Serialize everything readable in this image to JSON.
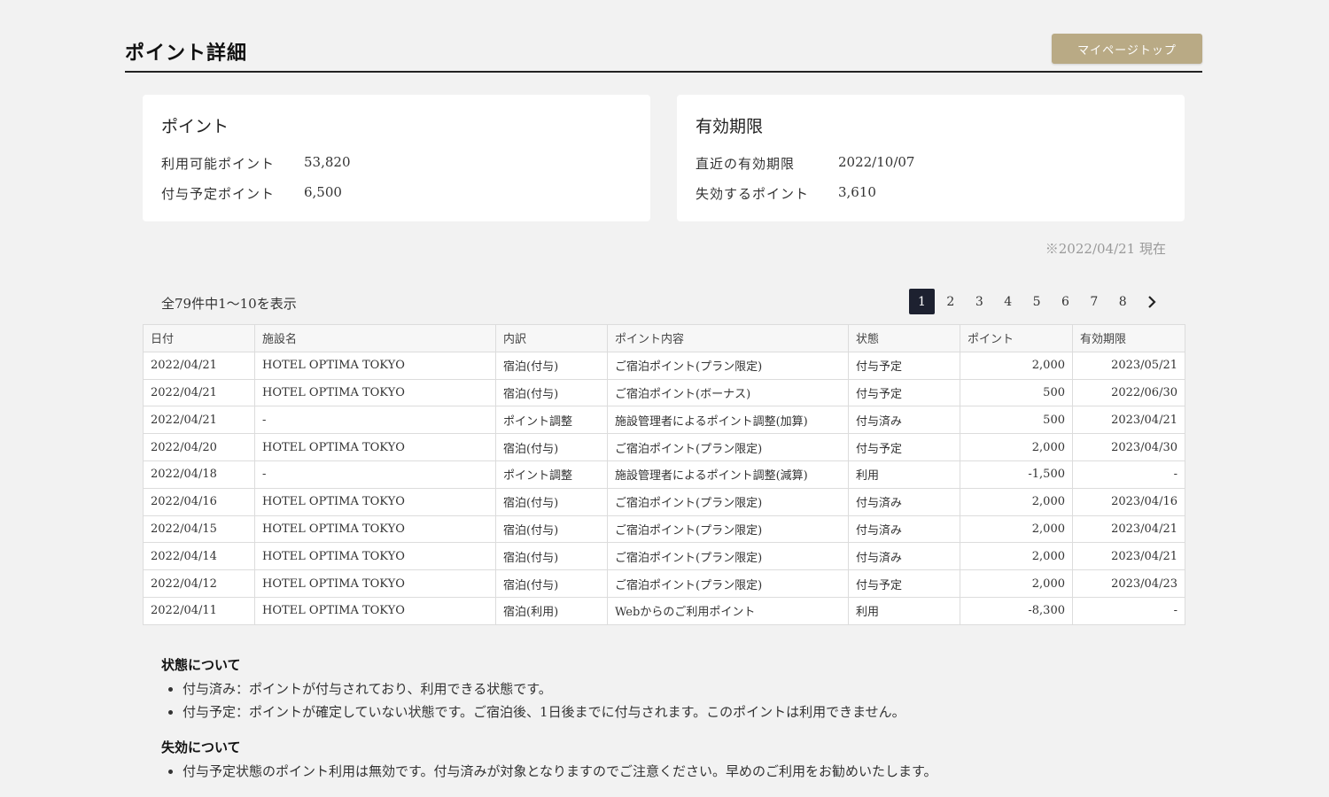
{
  "header": {
    "title": "ポイント詳細",
    "mypage_button": "マイページトップ"
  },
  "points_card": {
    "title": "ポイント",
    "rows": [
      {
        "label": "利用可能ポイント",
        "value": "53,820"
      },
      {
        "label": "付与予定ポイント",
        "value": "6,500"
      }
    ]
  },
  "expiry_card": {
    "title": "有効期限",
    "rows": [
      {
        "label": "直近の有効期限",
        "value": "2022/10/07"
      },
      {
        "label": "失効するポイント",
        "value": "3,610"
      }
    ]
  },
  "as_of": "※2022/04/21 現在",
  "list": {
    "count_text": "全79件中1～10を表示",
    "pages": [
      "1",
      "2",
      "3",
      "4",
      "5",
      "6",
      "7",
      "8"
    ],
    "current_page": "1",
    "next_icon": "chevron-right-icon",
    "columns": [
      "日付",
      "施設名",
      "内訳",
      "ポイント内容",
      "状態",
      "ポイント",
      "有効期限"
    ],
    "rows": [
      [
        "2022/04/21",
        "HOTEL OPTIMA TOKYO",
        "宿泊(付与)",
        "ご宿泊ポイント(プラン限定)",
        "付与予定",
        "2,000",
        "2023/05/21"
      ],
      [
        "2022/04/21",
        "HOTEL OPTIMA TOKYO",
        "宿泊(付与)",
        "ご宿泊ポイント(ボーナス)",
        "付与予定",
        "500",
        "2022/06/30"
      ],
      [
        "2022/04/21",
        "-",
        "ポイント調整",
        "施設管理者によるポイント調整(加算)",
        "付与済み",
        "500",
        "2023/04/21"
      ],
      [
        "2022/04/20",
        "HOTEL OPTIMA TOKYO",
        "宿泊(付与)",
        "ご宿泊ポイント(プラン限定)",
        "付与予定",
        "2,000",
        "2023/04/30"
      ],
      [
        "2022/04/18",
        "-",
        "ポイント調整",
        "施設管理者によるポイント調整(減算)",
        "利用",
        "-1,500",
        "-"
      ],
      [
        "2022/04/16",
        "HOTEL OPTIMA TOKYO",
        "宿泊(付与)",
        "ご宿泊ポイント(プラン限定)",
        "付与済み",
        "2,000",
        "2023/04/16"
      ],
      [
        "2022/04/15",
        "HOTEL OPTIMA TOKYO",
        "宿泊(付与)",
        "ご宿泊ポイント(プラン限定)",
        "付与済み",
        "2,000",
        "2023/04/21"
      ],
      [
        "2022/04/14",
        "HOTEL OPTIMA TOKYO",
        "宿泊(付与)",
        "ご宿泊ポイント(プラン限定)",
        "付与済み",
        "2,000",
        "2023/04/21"
      ],
      [
        "2022/04/12",
        "HOTEL OPTIMA TOKYO",
        "宿泊(付与)",
        "ご宿泊ポイント(プラン限定)",
        "付与予定",
        "2,000",
        "2023/04/23"
      ],
      [
        "2022/04/11",
        "HOTEL OPTIMA TOKYO",
        "宿泊(利用)",
        "Webからのご利用ポイント",
        "利用",
        "-8,300",
        "-"
      ]
    ]
  },
  "notes": [
    {
      "heading": "状態について",
      "items": [
        "付与済み：ポイントが付与されており、利用できる状態です。",
        "付与予定：ポイントが確定していない状態です。ご宿泊後、1日後までに付与されます。このポイントは利用できません。"
      ]
    },
    {
      "heading": "失効について",
      "items": [
        "付与予定状態のポイント利用は無効です。付与済みが対象となりますのでご注意ください。早めのご利用をお勧めいたします。"
      ]
    }
  ],
  "colors": {
    "background": "#f2f2f2",
    "accent_gold": "#b9aa85",
    "page_active": "#1d2130"
  }
}
